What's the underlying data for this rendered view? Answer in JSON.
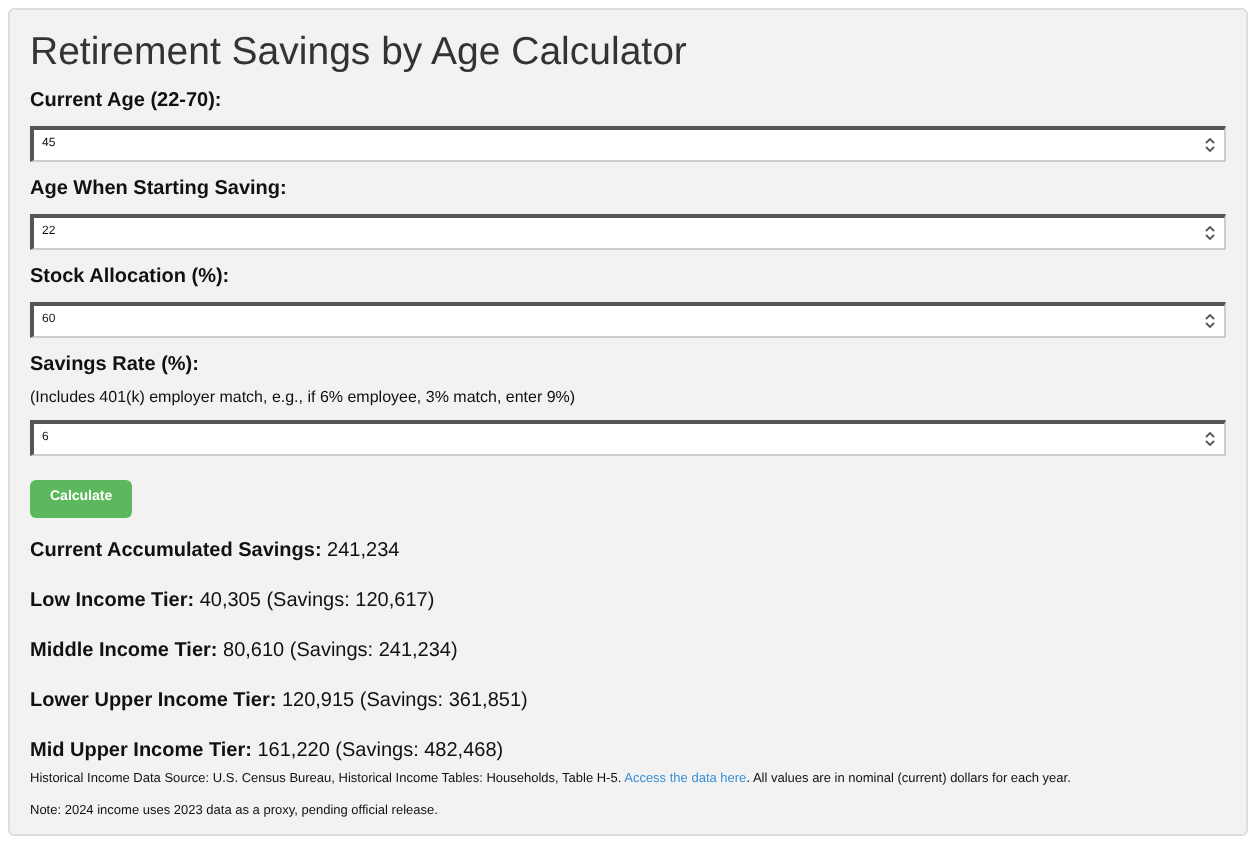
{
  "title": "Retirement Savings by Age Calculator",
  "fields": [
    {
      "label": "Current Age (22-70):",
      "value": "45"
    },
    {
      "label": "Age When Starting Saving:",
      "value": "22"
    },
    {
      "label": "Stock Allocation (%):",
      "value": "60"
    },
    {
      "label": "Savings Rate (%):",
      "hint": "(Includes 401(k) employer match, e.g., if 6% employee, 3% match, enter 9%)",
      "value": "6"
    }
  ],
  "button": "Calculate",
  "results": [
    "**Current Accumulated Savings:** 241,234",
    "**Low Income Tier:** 40,305 (Savings: 120,617)",
    "**Middle Income Tier:** 80,610 (Savings: 241,234)",
    "**Lower Upper Income Tier:** 120,915 (Savings: 361,851)",
    "**Mid Upper Income Tier:** 161,220 (Savings: 482,468)"
  ],
  "source": {
    "before": "Historical Income Data Source: U.S. Census Bureau, Historical Income Tables: Households, Table H-5.",
    "link": "Access the data here",
    "after": ". All values are in nominal (current) dollars for each year."
  },
  "note": "Note: 2024 income uses 2023 data as a proxy, pending official release."
}
